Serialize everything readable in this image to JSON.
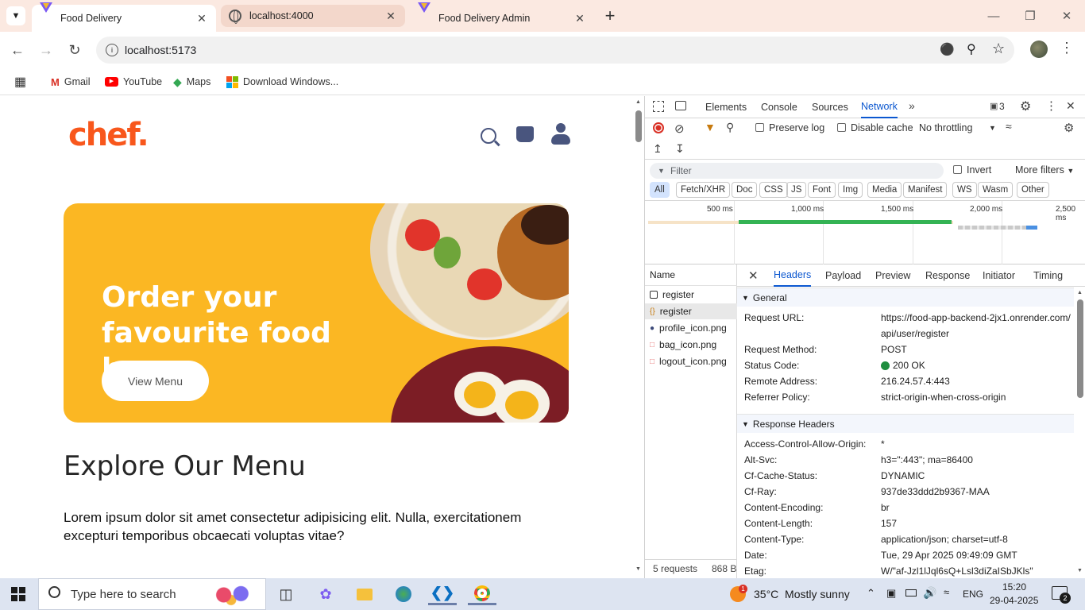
{
  "browser": {
    "tabs": [
      {
        "title": "Food Delivery",
        "icon": "vite-icon",
        "active": true
      },
      {
        "title": "localhost:4000",
        "icon": "globe-icon",
        "active": false
      },
      {
        "title": "Food Delivery Admin",
        "icon": "vite-icon",
        "active": false
      }
    ],
    "new_tab": "+",
    "url": "localhost:5173",
    "bookmarks": [
      {
        "label": "Gmail",
        "icon": "gmail-icon"
      },
      {
        "label": "YouTube",
        "icon": "youtube-icon"
      },
      {
        "label": "Maps",
        "icon": "maps-icon"
      },
      {
        "label": "Download Windows...",
        "icon": "windows-icon"
      }
    ]
  },
  "page": {
    "logo": "chef",
    "logo_dot": ".",
    "hero_title": "Order your favourite food here",
    "hero_button": "View Menu",
    "section_title": "Explore Our Menu",
    "section_text": "Lorem ipsum dolor sit amet consectetur adipisicing elit. Nulla, exercitationem excepturi temporibus obcaecati voluptas vitae?"
  },
  "devtools": {
    "tabs": [
      "Elements",
      "Console",
      "Sources",
      "Network"
    ],
    "active_tab": "Network",
    "issues_count": "3",
    "preserve_log": "Preserve log",
    "disable_cache": "Disable cache",
    "throttling": "No throttling",
    "filter_placeholder": "Filter",
    "invert": "Invert",
    "more_filters": "More filters",
    "type_filters": [
      "All",
      "Fetch/XHR",
      "Doc",
      "CSS",
      "JS",
      "Font",
      "Img",
      "Media",
      "Manifest",
      "WS",
      "Wasm",
      "Other"
    ],
    "timeline_ticks": [
      "500 ms",
      "1,000 ms",
      "1,500 ms",
      "2,000 ms",
      "2,500 ms"
    ],
    "name_header": "Name",
    "requests": [
      {
        "name": "register",
        "icon": "checkbox-icon"
      },
      {
        "name": "register",
        "icon": "xhr-icon"
      },
      {
        "name": "profile_icon.png",
        "icon": "image-icon"
      },
      {
        "name": "bag_icon.png",
        "icon": "image-icon"
      },
      {
        "name": "logout_icon.png",
        "icon": "image-icon"
      }
    ],
    "footer_requests": "5 requests",
    "footer_size": "868 B",
    "detail_tabs": [
      "Headers",
      "Payload",
      "Preview",
      "Response",
      "Initiator",
      "Timing"
    ],
    "active_detail_tab": "Headers",
    "general_title": "General",
    "general": [
      {
        "k": "Request URL:",
        "v": "https://food-app-backend-2jx1.onrender.com/api/user/register"
      },
      {
        "k": "Request Method:",
        "v": "POST"
      },
      {
        "k": "Status Code:",
        "v": "200 OK"
      },
      {
        "k": "Remote Address:",
        "v": "216.24.57.4:443"
      },
      {
        "k": "Referrer Policy:",
        "v": "strict-origin-when-cross-origin"
      }
    ],
    "response_title": "Response Headers",
    "response_headers": [
      {
        "k": "Access-Control-Allow-Origin:",
        "v": "*"
      },
      {
        "k": "Alt-Svc:",
        "v": "h3=\":443\"; ma=86400"
      },
      {
        "k": "Cf-Cache-Status:",
        "v": "DYNAMIC"
      },
      {
        "k": "Cf-Ray:",
        "v": "937de33ddd2b9367-MAA"
      },
      {
        "k": "Content-Encoding:",
        "v": "br"
      },
      {
        "k": "Content-Length:",
        "v": "157"
      },
      {
        "k": "Content-Type:",
        "v": "application/json; charset=utf-8"
      },
      {
        "k": "Date:",
        "v": "Tue, 29 Apr 2025 09:49:09 GMT"
      },
      {
        "k": "Etag:",
        "v": "W/\"af-Jzl1lJql6sQ+Lsl3diZaISbJKls\""
      }
    ]
  },
  "taskbar": {
    "search_placeholder": "Type here to search",
    "weather_badge": "1",
    "weather": "35°C  Mostly sunny",
    "language": "ENG",
    "time": "15:20",
    "date": "29-04-2025",
    "notifications": "2"
  },
  "colors": {
    "brand": "#f8571c",
    "hero": "#fbb723",
    "devtools_accent": "#0b57d0",
    "status_ok": "#1e8e3e"
  }
}
